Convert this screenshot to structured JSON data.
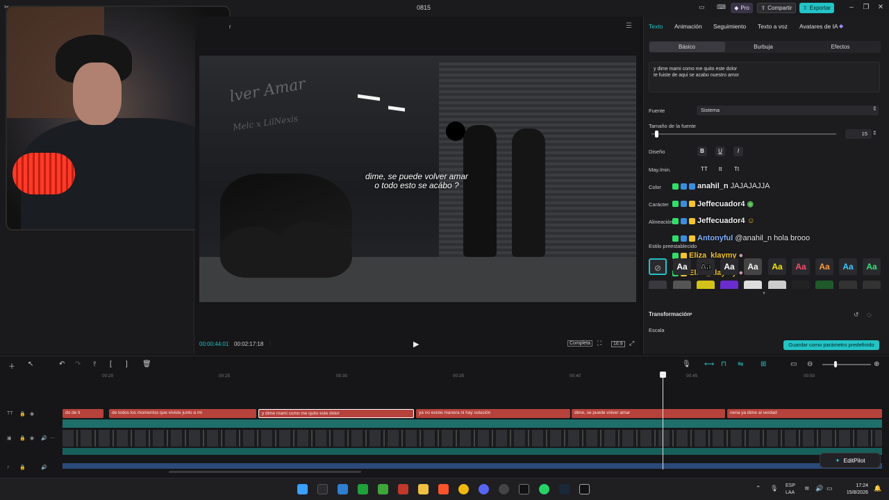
{
  "window": {
    "title": "0815",
    "pro_label": "Pro",
    "share_label": "Compartir",
    "export_label": "Exportar"
  },
  "player": {
    "title_fragment": "r",
    "wall_text": "lver Amar",
    "wall_sub": "Melc x LilNexis",
    "subtitle_line1": "dime, se puede volver amar",
    "subtitle_line2": "o todo esto se acábo ?",
    "time_current": "00:00:44:01",
    "time_total": "00:02:17:18",
    "full_label": "Completa",
    "ratio_label": "16:9"
  },
  "props": {
    "tabs": [
      "Texto",
      "Animación",
      "Seguimiento",
      "Texto a voz",
      "Avatares de IA"
    ],
    "subtabs": [
      "Básico",
      "Burbuja",
      "Efectos"
    ],
    "text_line1": "y dime mami como me quito este dolor",
    "text_line2": "te fuiste de aqui se acabo nuestro amor",
    "labels": {
      "font": "Fuente",
      "font_size": "Tamaño de la fuente",
      "design": "Diseño",
      "case": "May./min.",
      "color": "Color",
      "character": "Carácter",
      "alignment": "Alineación",
      "preset_style": "Estilo preestablecido",
      "transform": "Transformación",
      "scale": "Escala"
    },
    "font_value": "Sistema",
    "font_size_value": "15",
    "format_buttons": [
      "B",
      "U",
      "I"
    ],
    "case_buttons": [
      "TT",
      "tt",
      "Tt"
    ],
    "preset_label": "Aa",
    "save_preset": "Guardar como parámetro predefinido"
  },
  "chat": [
    {
      "user": "anahil_n",
      "message": "JAJAJAJJA",
      "color": "white"
    },
    {
      "user": "Jeffecuador4",
      "message": "",
      "color": "white"
    },
    {
      "user": "Jeffecuador4",
      "message": "",
      "color": "white"
    },
    {
      "user": "Antonyful",
      "message": "@anahil_n hola brooo",
      "color": "blue"
    },
    {
      "user": "Eliza_klaymy",
      "message": "",
      "color": "yellow"
    },
    {
      "user": "Eliza_klaymy",
      "message": "",
      "color": "yellow"
    }
  ],
  "timeline": {
    "ticks": [
      "00:20",
      "00:25",
      "00:30",
      "00:35",
      "00:40",
      "00:45",
      "00:50"
    ],
    "clips": [
      "do de ti",
      "de todos los momentos que viviste junto a mí",
      "y dime mami como me quito este dolor",
      "ya no existe manera ni hay solución",
      "dime, se puede volver amar",
      "nena ya dime al verdad"
    ],
    "editpilot": "EditPilot"
  },
  "taskbar": {
    "lang1": "ESP",
    "lang2": "LAA",
    "time": "17:24",
    "date": "15/8/2026"
  },
  "colors": {
    "accent": "#23c4c6",
    "clip": "#b6423c"
  }
}
